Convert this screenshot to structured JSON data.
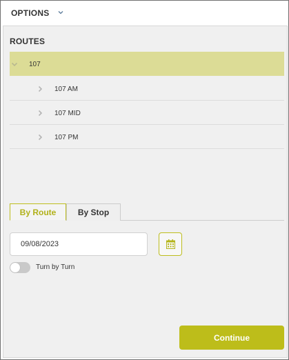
{
  "options": {
    "label": "OPTIONS",
    "icon": "chevron-down-icon"
  },
  "routes": {
    "heading": "ROUTES",
    "parent": {
      "label": "107",
      "icon": "chevron-down-icon",
      "expanded": true
    },
    "children": [
      {
        "label": "107 AM",
        "icon": "chevron-right-icon"
      },
      {
        "label": "107 MID",
        "icon": "chevron-right-icon"
      },
      {
        "label": "107 PM",
        "icon": "chevron-right-icon"
      }
    ]
  },
  "tabs": [
    {
      "label": "By Route",
      "active": true
    },
    {
      "label": "By Stop",
      "active": false
    }
  ],
  "date": {
    "value": "09/08/2023",
    "calendar_icon": "calendar-icon"
  },
  "toggle": {
    "label": "Turn by Turn",
    "on": false
  },
  "continue_button": {
    "label": "Continue"
  },
  "colors": {
    "accent": "#bdbd1a",
    "selected_row": "#dcdc96",
    "panel_bg": "#f0f0f0"
  }
}
